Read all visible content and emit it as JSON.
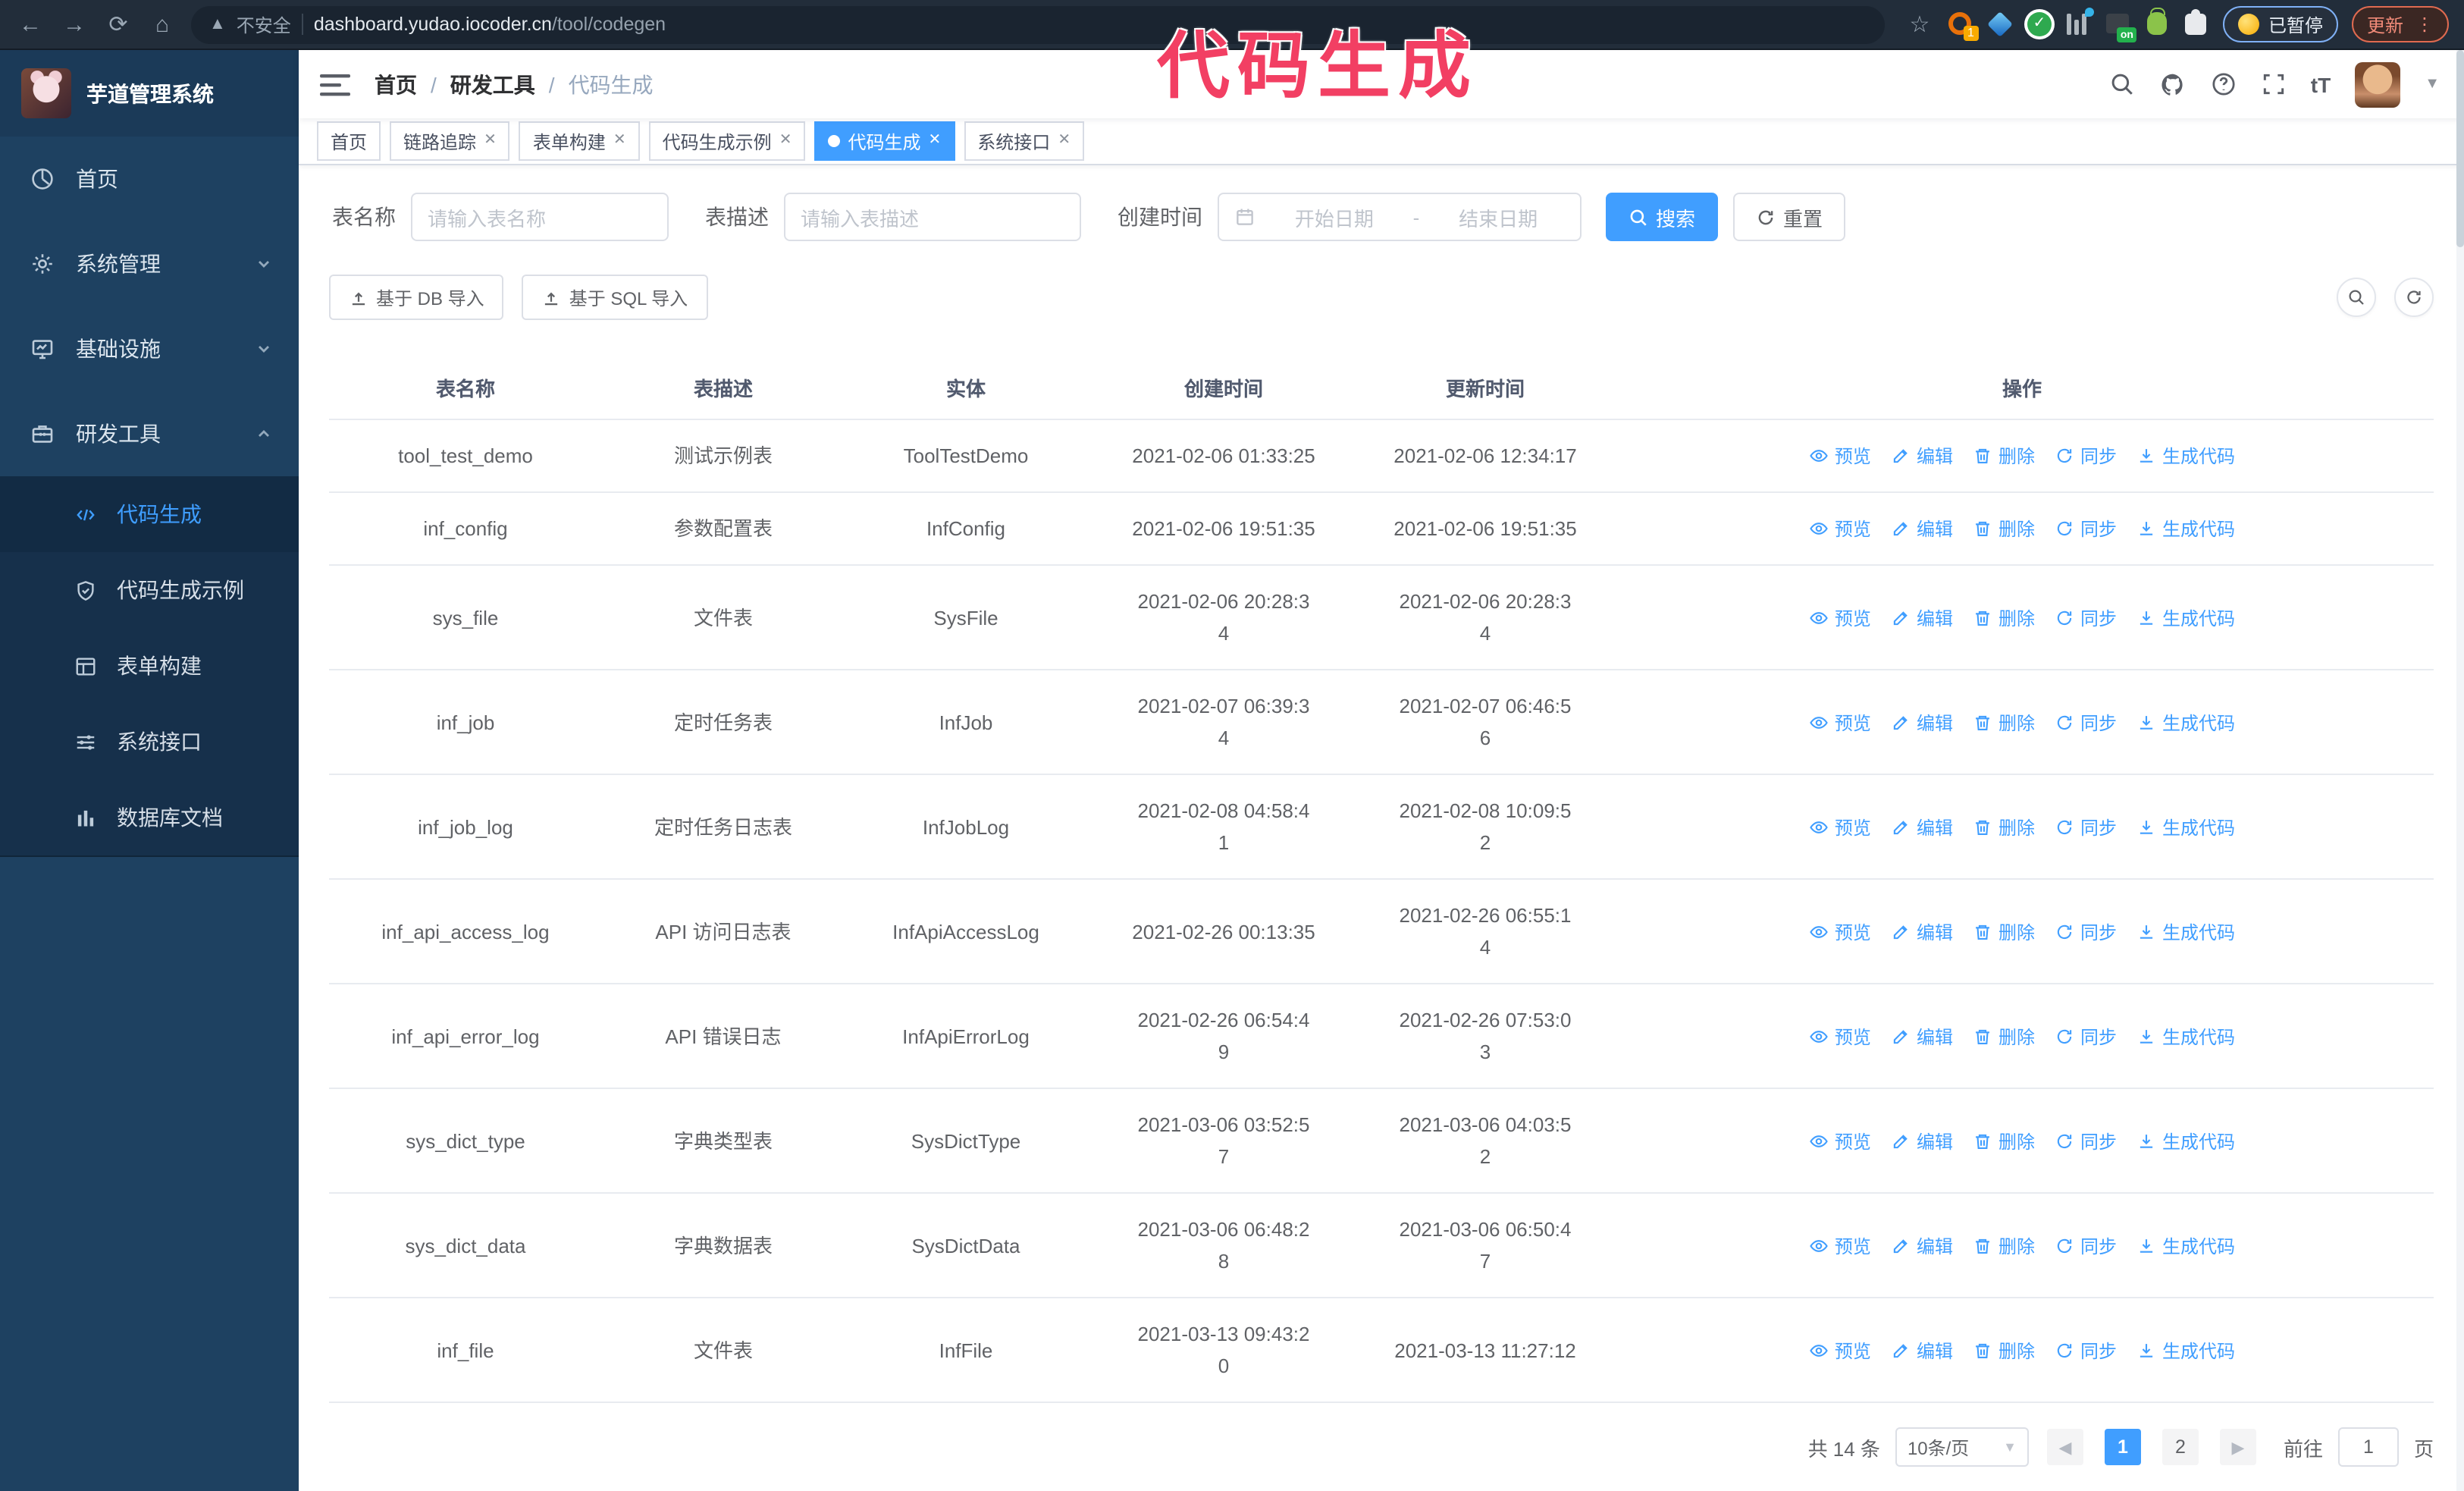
{
  "browser": {
    "security_label": "不安全",
    "url_host": "dashboard.yudao.iocoder.cn",
    "url_path": "/tool/codegen",
    "extension_badge": "1",
    "extension_on_badge": "on",
    "paused_badge": "已暂停",
    "update_button": "更新"
  },
  "annotation": {
    "text": "代码生成",
    "color": "#f23f63"
  },
  "sidebar": {
    "logo_title": "芋道管理系统",
    "menu": [
      {
        "label": "首页",
        "icon": "dashboard-icon"
      },
      {
        "label": "系统管理",
        "icon": "gear-icon",
        "chevron": "down"
      },
      {
        "label": "基础设施",
        "icon": "monitor-icon",
        "chevron": "down"
      },
      {
        "label": "研发工具",
        "icon": "toolbox-icon",
        "chevron": "up"
      }
    ],
    "submenu": [
      {
        "label": "代码生成",
        "icon": "code-icon",
        "active": true
      },
      {
        "label": "代码生成示例",
        "icon": "shield-check-icon"
      },
      {
        "label": "表单构建",
        "icon": "form-icon"
      },
      {
        "label": "系统接口",
        "icon": "sliders-icon"
      },
      {
        "label": "数据库文档",
        "icon": "columns-icon"
      }
    ]
  },
  "header": {
    "breadcrumb": [
      "首页",
      "研发工具",
      "代码生成"
    ],
    "separator": "/"
  },
  "tabs": [
    {
      "label": "首页"
    },
    {
      "label": "链路追踪"
    },
    {
      "label": "表单构建"
    },
    {
      "label": "代码生成示例"
    },
    {
      "label": "代码生成",
      "active": true
    },
    {
      "label": "系统接口"
    }
  ],
  "filters": {
    "name_label": "表名称",
    "name_placeholder": "请输入表名称",
    "desc_label": "表描述",
    "desc_placeholder": "请输入表描述",
    "time_label": "创建时间",
    "start_placeholder": "开始日期",
    "range_separator": "-",
    "end_placeholder": "结束日期",
    "search_button": "搜索",
    "reset_button": "重置"
  },
  "toolbar": {
    "import_db_button": "基于 DB 导入",
    "import_sql_button": "基于 SQL 导入"
  },
  "table": {
    "columns": [
      "表名称",
      "表描述",
      "实体",
      "创建时间",
      "更新时间",
      "操作"
    ],
    "actions": [
      "预览",
      "编辑",
      "删除",
      "同步",
      "生成代码"
    ],
    "rows": [
      {
        "name": "tool_test_demo",
        "desc": "测试示例表",
        "entity": "ToolTestDemo",
        "created": "2021-02-06 01:33:25",
        "updated": "2021-02-06 12:34:17"
      },
      {
        "name": "inf_config",
        "desc": "参数配置表",
        "entity": "InfConfig",
        "created": "2021-02-06 19:51:35",
        "updated": "2021-02-06 19:51:35"
      },
      {
        "name": "sys_file",
        "desc": "文件表",
        "entity": "SysFile",
        "created": "2021-02-06 20:28:3\n4",
        "updated": "2021-02-06 20:28:3\n4"
      },
      {
        "name": "inf_job",
        "desc": "定时任务表",
        "entity": "InfJob",
        "created": "2021-02-07 06:39:3\n4",
        "updated": "2021-02-07 06:46:5\n6"
      },
      {
        "name": "inf_job_log",
        "desc": "定时任务日志表",
        "entity": "InfJobLog",
        "created": "2021-02-08 04:58:4\n1",
        "updated": "2021-02-08 10:09:5\n2"
      },
      {
        "name": "inf_api_access_log",
        "desc": "API 访问日志表",
        "entity": "InfApiAccessLog",
        "created": "2021-02-26 00:13:35",
        "updated": "2021-02-26 06:55:1\n4"
      },
      {
        "name": "inf_api_error_log",
        "desc": "API 错误日志",
        "entity": "InfApiErrorLog",
        "created": "2021-02-26 06:54:4\n9",
        "updated": "2021-02-26 07:53:0\n3"
      },
      {
        "name": "sys_dict_type",
        "desc": "字典类型表",
        "entity": "SysDictType",
        "created": "2021-03-06 03:52:5\n7",
        "updated": "2021-03-06 04:03:5\n2"
      },
      {
        "name": "sys_dict_data",
        "desc": "字典数据表",
        "entity": "SysDictData",
        "created": "2021-03-06 06:48:2\n8",
        "updated": "2021-03-06 06:50:4\n7"
      },
      {
        "name": "inf_file",
        "desc": "文件表",
        "entity": "InfFile",
        "created": "2021-03-13 09:43:2\n0",
        "updated": "2021-03-13 11:27:12"
      }
    ]
  },
  "pagination": {
    "total": "共 14 条",
    "page_size": "10条/页",
    "pages": [
      "1",
      "2"
    ],
    "active_page": "1",
    "goto_label": "前往",
    "goto_value": "1",
    "page_label": "页"
  },
  "colors": {
    "accent": "#409eff",
    "sidebar": "#1e4161",
    "submenu": "#16304b",
    "chrome": "#222d3a"
  }
}
